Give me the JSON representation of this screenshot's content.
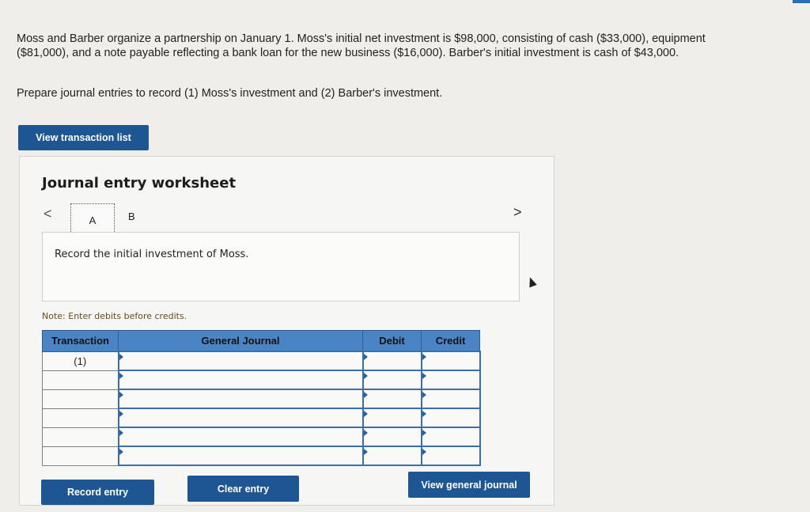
{
  "problem": {
    "text": "Moss and Barber organize a partnership on January 1. Moss's initial net investment is $98,000, consisting of cash ($33,000), equipment ($81,000), and a note payable reflecting a bank loan for the new business ($16,000). Barber's initial investment is cash of $43,000.",
    "prompt": "Prepare journal entries to record (1) Moss's investment and (2) Barber's investment."
  },
  "buttons": {
    "view_transaction_list": "View transaction list",
    "record_entry": "Record entry",
    "clear_entry": "Clear entry",
    "view_general_journal": "View general journal"
  },
  "worksheet": {
    "title": "Journal entry worksheet",
    "nav_prev": "<",
    "nav_next": ">",
    "tabs": [
      {
        "label": "A",
        "active": true
      },
      {
        "label": "B",
        "active": false
      }
    ],
    "instruction": "Record the initial investment of Moss.",
    "note": "Note: Enter debits before credits."
  },
  "table": {
    "headers": [
      "Transaction",
      "General Journal",
      "Debit",
      "Credit"
    ],
    "rows": [
      {
        "transaction": "(1)",
        "account": "",
        "debit": "",
        "credit": ""
      },
      {
        "transaction": "",
        "account": "",
        "debit": "",
        "credit": ""
      },
      {
        "transaction": "",
        "account": "",
        "debit": "",
        "credit": ""
      },
      {
        "transaction": "",
        "account": "",
        "debit": "",
        "credit": ""
      },
      {
        "transaction": "",
        "account": "",
        "debit": "",
        "credit": ""
      },
      {
        "transaction": "",
        "account": "",
        "debit": "",
        "credit": ""
      }
    ]
  },
  "colors": {
    "primary_button": "#1e5694",
    "table_header": "#4b84c4",
    "input_border": "#3a6fad"
  }
}
